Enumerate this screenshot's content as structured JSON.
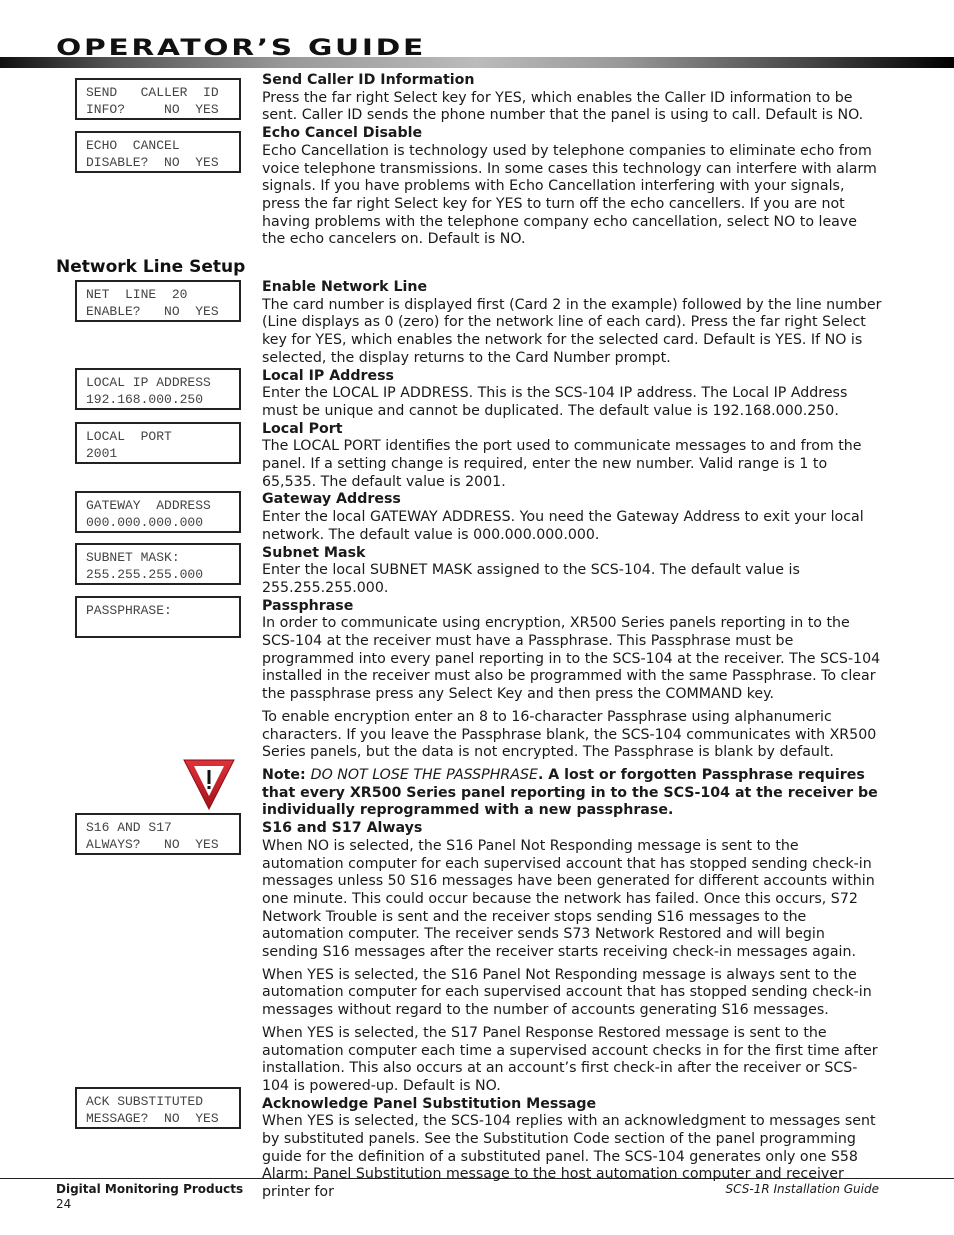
{
  "header": {
    "title": "OPERATOR’S GUIDE"
  },
  "section_heading": "Network Line Setup",
  "lcd_displays": [
    {
      "line1": "SEND   CALLER  ID",
      "line2": "INFO?     NO  YES"
    },
    {
      "line1": "ECHO  CANCEL",
      "line2": "DISABLE?  NO  YES"
    },
    {
      "line1": "NET  LINE  20",
      "line2": "ENABLE?   NO  YES"
    },
    {
      "line1": "LOCAL IP ADDRESS",
      "line2": "192.168.000.250"
    },
    {
      "line1": "LOCAL  PORT",
      "line2": "2001"
    },
    {
      "line1": "GATEWAY  ADDRESS",
      "line2": "000.000.000.000"
    },
    {
      "line1": "SUBNET MASK:",
      "line2": "255.255.255.000"
    },
    {
      "line1": "PASSPHRASE:",
      "line2": ""
    },
    {
      "line1": "S16 AND S17",
      "line2": "ALWAYS?   NO  YES"
    },
    {
      "line1": "ACK SUBSTITUTED",
      "line2": "MESSAGE?  NO  YES"
    }
  ],
  "sections": {
    "send_caller_id": {
      "title": "Send Caller ID Information",
      "body": "Press the far right Select key for YES, which enables the Caller ID information to be sent. Caller ID sends the phone number that the panel is using to call.  Default is NO."
    },
    "echo_cancel": {
      "title": "Echo Cancel Disable",
      "body": "Echo Cancellation is technology used by telephone companies to eliminate echo from voice telephone transmissions.  In some cases this technology can interfere with alarm signals.  If you have problems with Echo Cancellation interfering with your signals, press the far right Select key for YES to turn off the echo cancellers.  If you are not having problems with the telephone company echo cancellation, select NO to leave the echo cancelers on.  Default is NO."
    },
    "enable_network": {
      "title": "Enable Network Line",
      "body": "The card number is displayed first (Card 2 in the example) followed by the line number (Line displays as 0 (zero) for the network line of each card). Press the far right Select key for YES, which enables the network for the selected card.  Default is YES. If NO is selected, the display returns to the Card Number prompt."
    },
    "local_ip": {
      "title": "Local IP Address",
      "body": "Enter the LOCAL IP ADDRESS.  This is the SCS-104 IP address.  The Local IP Address must be unique and cannot be duplicated.  The default value is 192.168.000.250."
    },
    "local_port": {
      "title": "Local Port",
      "body": "The LOCAL PORT identifies the port used to communicate messages to and from the panel.  If a setting change is required, enter the new number.  Valid range is 1 to 65,535.  The default value is 2001."
    },
    "gateway": {
      "title": "Gateway Address",
      "body": "Enter the local GATEWAY ADDRESS.  You need the Gateway Address to exit your local network.  The default value is 000.000.000.000."
    },
    "subnet": {
      "title": "Subnet Mask",
      "body": "Enter the local SUBNET MASK assigned to the SCS-104.  The default value is 255.255.255.000."
    },
    "passphrase": {
      "title": "Passphrase",
      "body1": "In order to communicate using encryption, XR500 Series panels reporting in to the SCS-104 at the receiver must have a Passphrase. This Passphrase must be programmed into every panel reporting in to the SCS-104 at the receiver.  The SCS-104 installed in the receiver must also be programmed with the same Passphrase.  To clear the passphrase press any Select Key and then press the COMMAND key.",
      "body2": "To enable encryption enter an 8 to 16-character Passphrase using alphanumeric characters.  If you leave the Passphrase blank, the SCS-104 communicates with XR500 Series panels, but the data is not encrypted.  The Passphrase is blank by default.",
      "note_label": "Note: ",
      "note_italic": "DO NOT LOSE THE PASSPHRASE",
      "note_rest": ".  A lost or forgotten Passphrase requires that every XR500 Series panel reporting in to the SCS-104 at the receiver be individually reprogrammed with a new passphrase."
    },
    "s16_s17": {
      "title": "S16 and S17 Always",
      "body1": "When NO is selected, the S16 Panel Not Responding message is sent to the automation computer for each supervised account that has stopped sending check-in messages unless 50 S16 messages have been generated for different accounts within one minute.  This could occur because the network has failed.  Once this occurs, S72 Network Trouble is sent and the receiver stops sending S16 messages to the automation computer.  The receiver sends S73 Network Restored and will begin sending S16 messages after the receiver starts receiving check-in messages again.",
      "body2": "When YES is selected, the S16 Panel Not Responding message is always sent to the automation computer for each supervised account that has stopped sending check-in messages without regard to the number of accounts generating S16 messages.",
      "body3": "When YES is selected, the S17 Panel Response Restored message is sent to the automation computer each time a supervised account checks in for the first time after installation.  This also occurs at an account’s first check-in after the receiver or SCS-104 is powered-up.  Default is NO."
    },
    "ack_substitution": {
      "title": "Acknowledge Panel Substitution Message",
      "body": "When YES is selected, the SCS-104 replies with an acknowledgment to messages sent by substituted panels. See the Substitution Code section of the panel programming guide for the definition of a substituted panel.  The SCS-104 generates only one S58 Alarm: Panel Substitution message to the host automation computer and receiver printer for"
    }
  },
  "icons": {
    "warning": "warning-yield-icon"
  },
  "footer": {
    "company": "Digital Monitoring Products",
    "page_number": "24",
    "guide_title": "SCS-1R Installation Guide"
  }
}
